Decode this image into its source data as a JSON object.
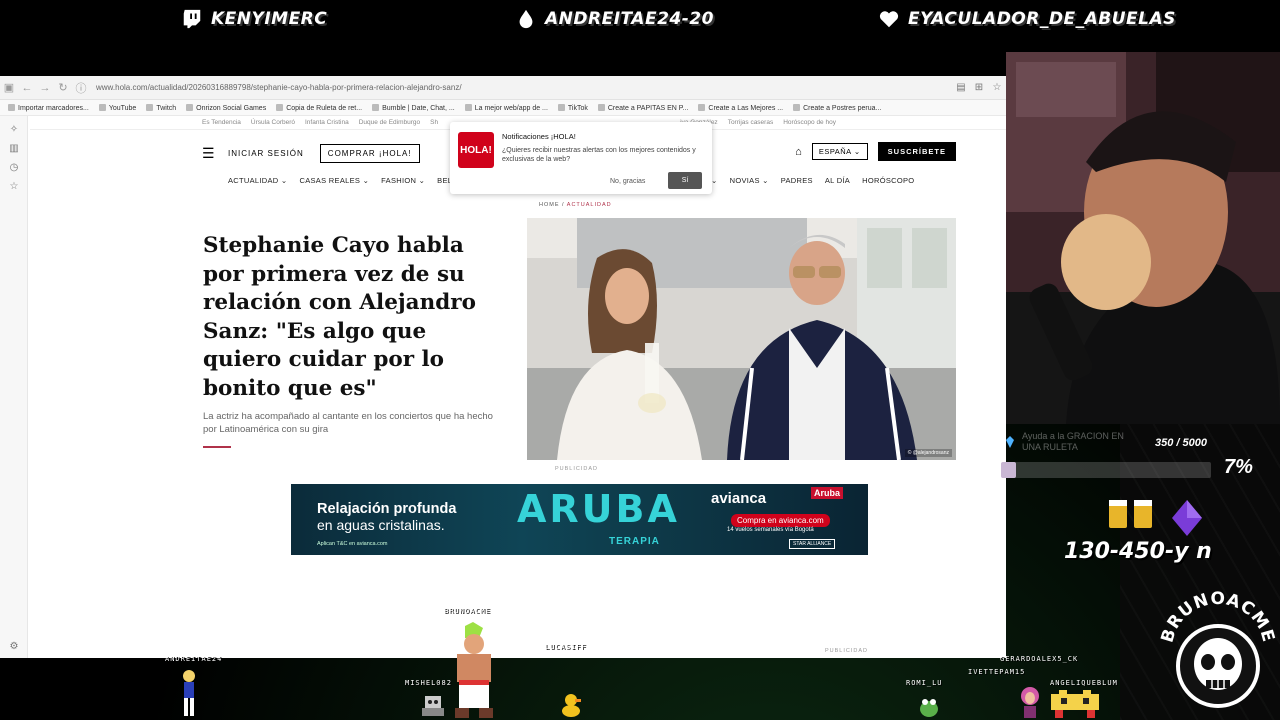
{
  "overlay": {
    "top_users": [
      {
        "name": "KENYIMERC",
        "icon": "twitch-icon"
      },
      {
        "name": "ANDREITAE24-20",
        "icon": "drop-icon"
      },
      {
        "name": "EYACULADOR_DE_ABUELAS",
        "icon": "heart-icon"
      }
    ],
    "goal": {
      "text": "Ayuda a la GRACION EN UNA RULETA",
      "count": "350 / 5000",
      "percent": "7%",
      "progress_fraction": 0.07
    },
    "sponsor_code": "130-450-y n",
    "streamer_logo": "BRUNOACME",
    "chat_users": [
      {
        "name": "ANDREITAE24"
      },
      {
        "name": "BRUNOACME"
      },
      {
        "name": "MISHEL082"
      },
      {
        "name": "LUCASIFF"
      },
      {
        "name": "ROMI_LU"
      },
      {
        "name": "IVETTEPAM15"
      },
      {
        "name": "GERARDOALEX5_CK"
      },
      {
        "name": "ANGELIQUEBLUM"
      }
    ]
  },
  "browser": {
    "url": "www.hola.com/actualidad/20260316889798/stephanie-cayo-habla-por-primera-relacion-alejandro-sanz/",
    "bookmarks": [
      "Importar marcadores...",
      "YouTube",
      "Twitch",
      "Onrizon Social Games",
      "Copia de Ruleta de ret...",
      "Bumble | Date, Chat, ...",
      "La mejor web/app de ...",
      "TikTok",
      "Create a PAPITAS EN P...",
      "Create a Las Mejores ...",
      "Create a Postres perua..."
    ]
  },
  "site": {
    "trending_label": "Es Tendencia",
    "trending": [
      "Úrsula Corberó",
      "Infanta Cristina",
      "Duque de Edimburgo",
      "Sh",
      "iva González",
      "Torrijas caseras",
      "Horóscopo de hoy"
    ],
    "login": "INICIAR SESIÓN",
    "buy": "COMPRAR ¡HOLA!",
    "region": "ESPAÑA",
    "subscribe": "SUSCRÍBETE",
    "nav": [
      "ACTUALIDAD",
      "CASAS REALES",
      "FASHION",
      "BELLE",
      "ES",
      "NOVIAS",
      "PADRES",
      "AL DÍA",
      "HORÓSCOPO"
    ],
    "breadcrumb": {
      "home": "HOME",
      "sep": "/",
      "current": "ACTUALIDAD"
    },
    "notification": {
      "logo": "HOLA!",
      "title": "Notificaciones ¡HOLA!",
      "body": "¿Quieres recibir nuestras alertas con los mejores contenidos y exclusivas de la web?",
      "decline": "No, gracias",
      "accept": "Sí"
    },
    "article": {
      "title": "Stephanie Cayo habla por primera vez de su relación con Alejandro Sanz: \"Es algo que quiero cuidar por lo bonito que es\"",
      "lead": "La actriz ha acompañado al cantante en los conciertos que ha hecho por Latinoamérica con su gira",
      "photo_credit": "© @alejandrosanz"
    },
    "ad_label": "PUBLICIDAD",
    "ad": {
      "line1": "Relajación profunda",
      "line2": "en aguas cristalinas.",
      "line3": "Aplican T&C en avianca.com",
      "aruba": "ARUBA",
      "terapia": "TERAPIA",
      "brand": "avianca",
      "cta": "Compra en avianca.com",
      "freq": "14 vuelos semanales vía Bogotá",
      "alliance": "STAR ALLIANCE",
      "dest_logo": "Aruba"
    },
    "ad_label_2": "PUBLICIDAD"
  }
}
